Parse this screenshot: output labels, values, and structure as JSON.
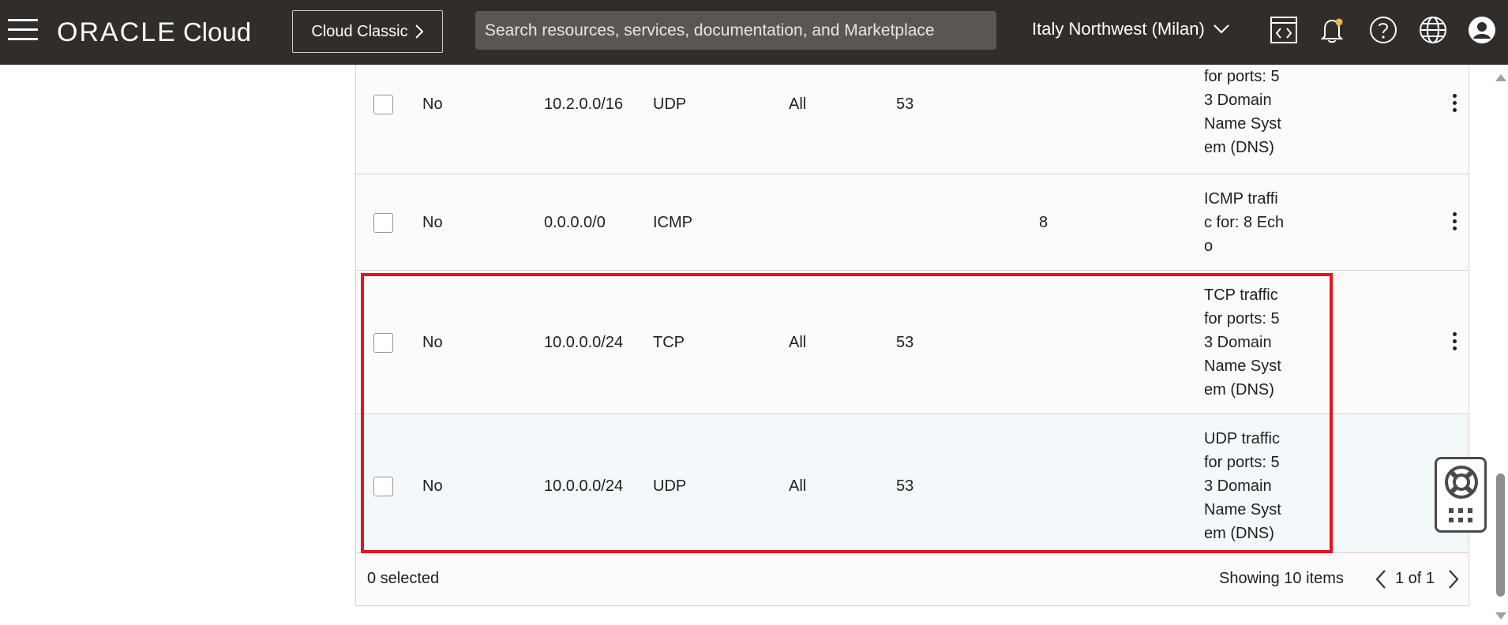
{
  "header": {
    "brand_oracle": "ORACLE",
    "brand_cloud": "Cloud",
    "classic_button": "Cloud Classic",
    "search_placeholder": "Search resources, services, documentation, and Marketplace",
    "region": "Italy Northwest (Milan)"
  },
  "rows": [
    {
      "stateless": "No",
      "source": "10.2.0.0/16",
      "protocol": "UDP",
      "src_port": "All",
      "dst_port": "53",
      "type_code": "",
      "desc_lines": [
        "for ports: 5",
        "3 Domain",
        "Name Syst",
        "em (DNS)"
      ]
    },
    {
      "stateless": "No",
      "source": "0.0.0.0/0",
      "protocol": "ICMP",
      "src_port": "",
      "dst_port": "",
      "type_code": "8",
      "desc_lines": [
        "ICMP traffi",
        "c for: 8 Ech",
        "o"
      ]
    },
    {
      "stateless": "No",
      "source": "10.0.0.0/24",
      "protocol": "TCP",
      "src_port": "All",
      "dst_port": "53",
      "type_code": "",
      "desc_lines": [
        "TCP traffic",
        "for ports: 5",
        "3 Domain",
        "Name Syst",
        "em (DNS)"
      ]
    },
    {
      "stateless": "No",
      "source": "10.0.0.0/24",
      "protocol": "UDP",
      "src_port": "All",
      "dst_port": "53",
      "type_code": "",
      "desc_lines": [
        "UDP traffic",
        "for ports: 5",
        "3 Domain",
        "Name Syst",
        "em (DNS)"
      ]
    }
  ],
  "footer": {
    "selected": "0 selected",
    "showing": "Showing 10 items",
    "page": "1 of 1"
  },
  "colors": {
    "header_bg": "#312d2a",
    "highlight_border": "#e8131b",
    "row_hover": "#f3f8fb"
  },
  "icons": [
    "menu-icon",
    "chevron-right-icon",
    "chevron-down-icon",
    "code-editor-icon",
    "bell-icon",
    "help-icon",
    "globe-icon",
    "user-icon",
    "kebab-icon",
    "lifebuoy-icon",
    "grid-icon"
  ]
}
